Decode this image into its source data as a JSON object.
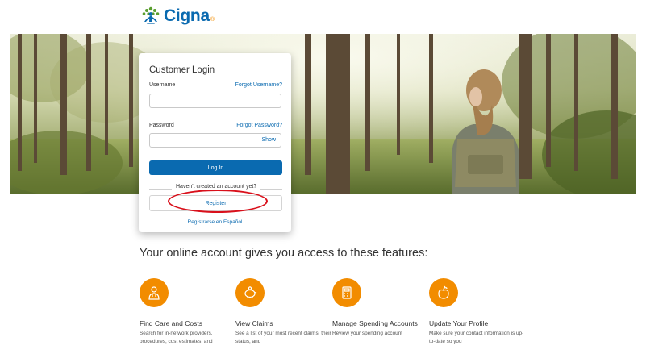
{
  "brand": {
    "name": "Cigna",
    "registered": "®",
    "primary_color": "#0a6ab0",
    "accent_color": "#f28c00"
  },
  "login": {
    "title": "Customer Login",
    "username_label": "Username",
    "forgot_username": "Forgot Username?",
    "password_label": "Password",
    "forgot_password": "Forgot Password?",
    "show_label": "Show",
    "login_button": "Log In",
    "no_account_text": "Haven't created an account yet?",
    "register_button": "Register",
    "spanish_link": "Regístrarse en Español"
  },
  "annotation": {
    "color": "#d9101b"
  },
  "features": {
    "heading": "Your online account gives you access to these features:",
    "items": [
      {
        "title": "Find Care and Costs",
        "desc": "Search for in-network providers, procedures, cost estimates, and",
        "icon": "doctor-icon"
      },
      {
        "title": "View Claims",
        "desc": "See a list of your most recent claims, their status, and",
        "icon": "piggy-bank-icon"
      },
      {
        "title": "Manage Spending Accounts",
        "desc": "Review your spending account",
        "icon": "calculator-icon"
      },
      {
        "title": "Update Your Profile",
        "desc": "Make sure your contact information is up-to-date so you",
        "icon": "apple-icon"
      }
    ]
  }
}
